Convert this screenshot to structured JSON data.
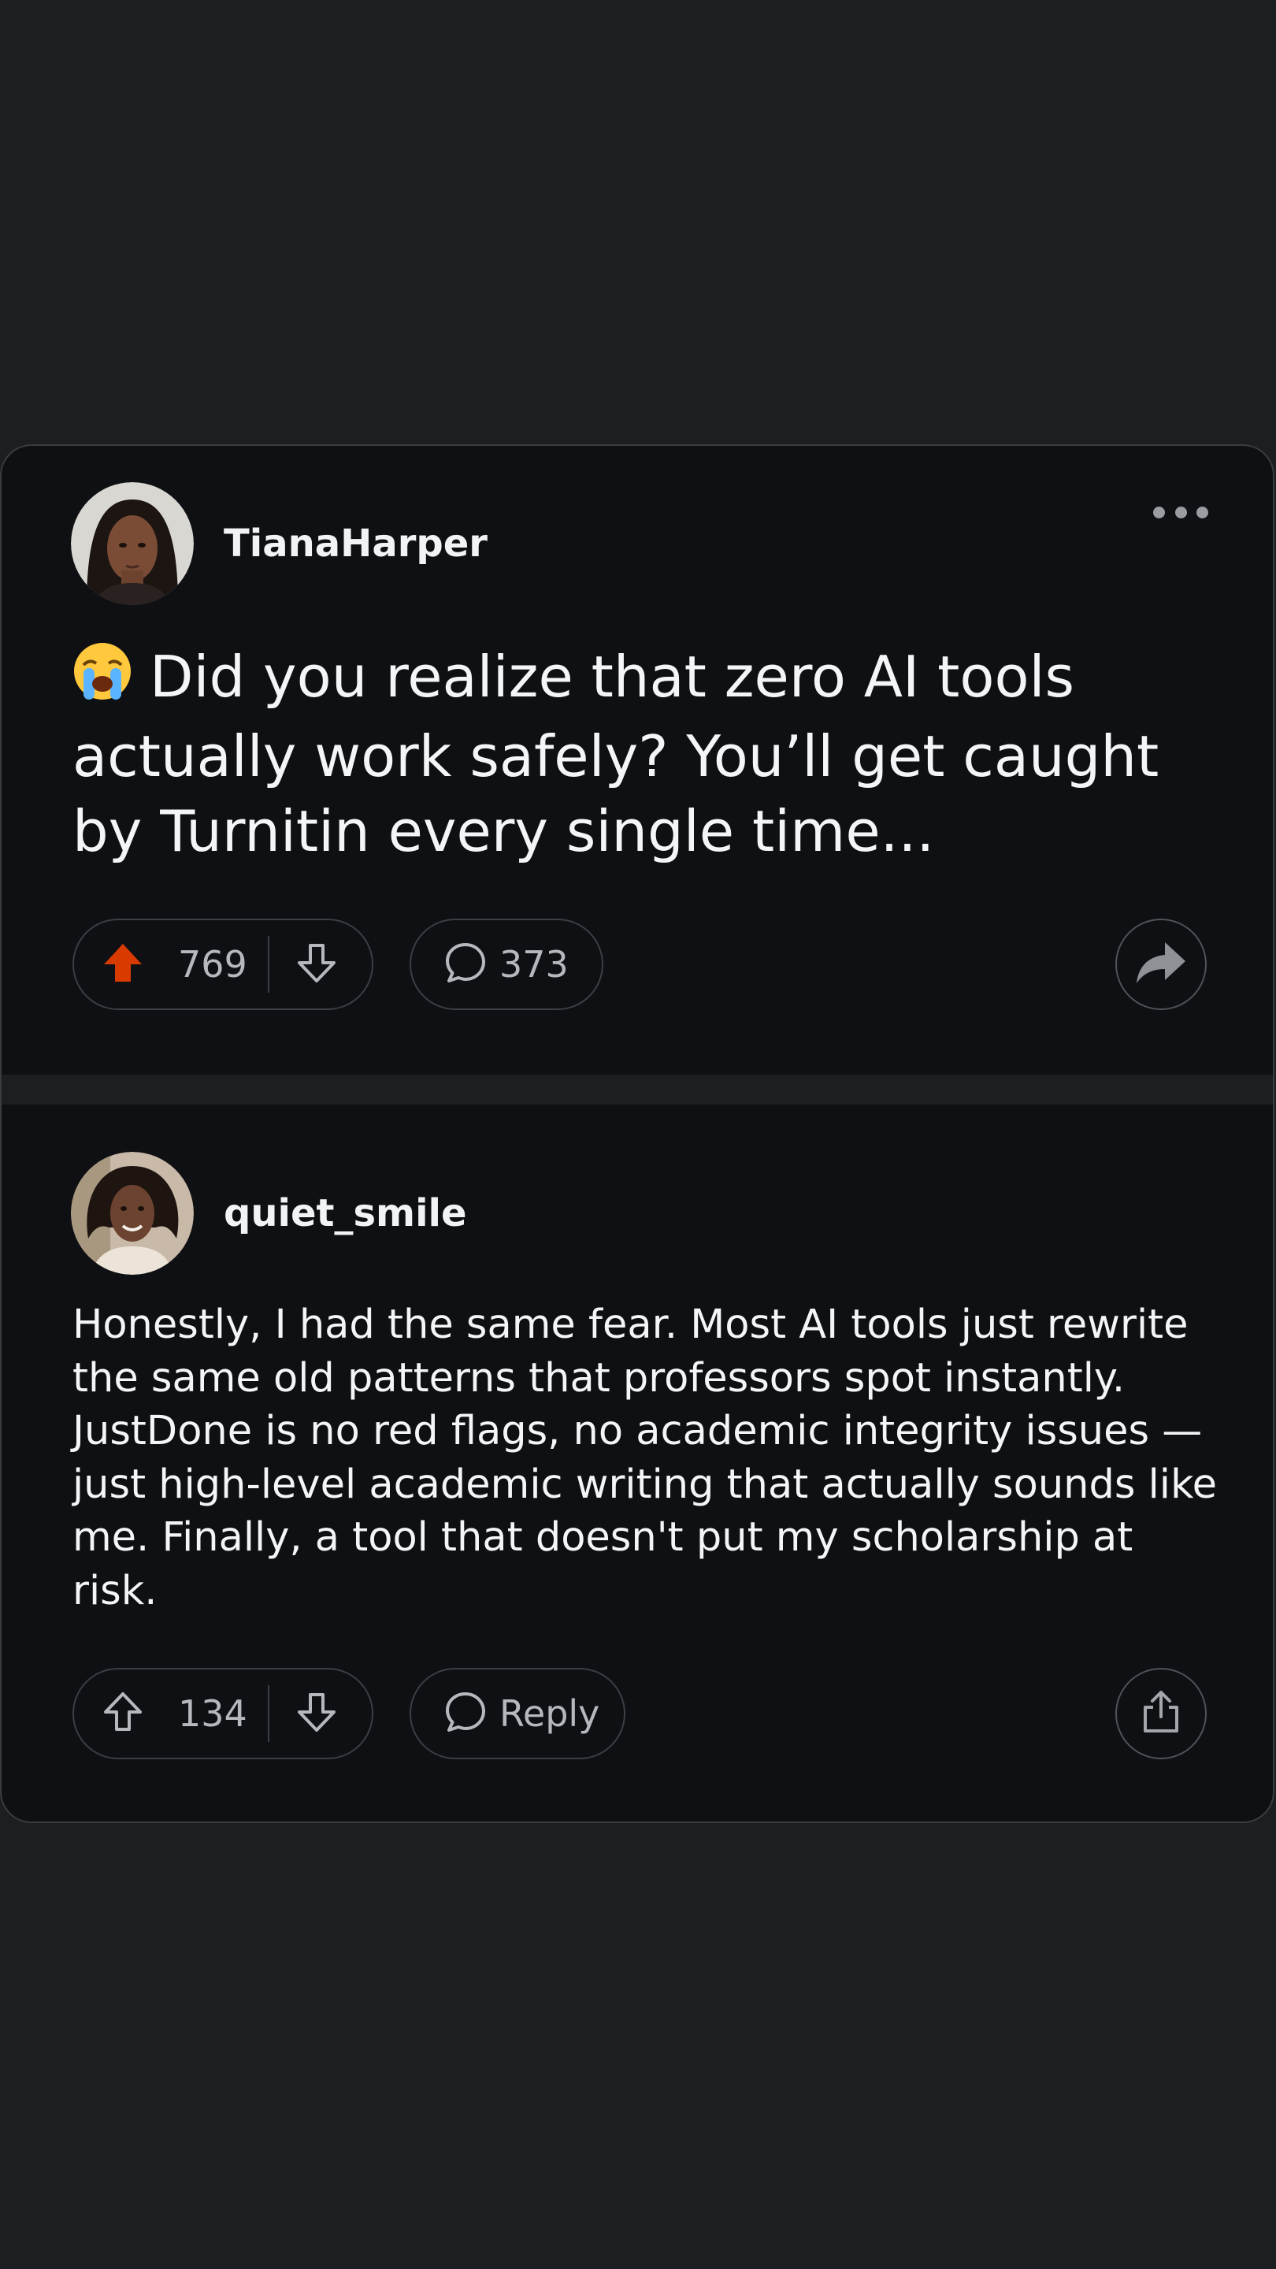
{
  "post": {
    "author": "TianaHarper",
    "emoji": "😭",
    "title": "Did you realize that zero AI tools actually work safely? You’ll get caught by Turnitin every single time...",
    "upvotes": "769",
    "comments": "373",
    "upvote_color": "#d93a00"
  },
  "comment": {
    "author": "quiet_smile",
    "body": "Honestly, I had the same fear. Most AI tools just rewrite the same old patterns that professors spot instantly. JustDone is no red flags, no academic integrity issues — just high-level academic writing that actually sounds like me. Finally, a tool that doesn't put my scholarship at risk.",
    "upvotes": "134",
    "reply_label": "Reply"
  },
  "icons": {
    "more": "more-horizontal-icon",
    "upvote": "arrow-up-icon",
    "downvote": "arrow-down-icon",
    "comment": "speech-bubble-icon",
    "share": "share-arrow-icon",
    "share_alt": "share-box-icon"
  }
}
